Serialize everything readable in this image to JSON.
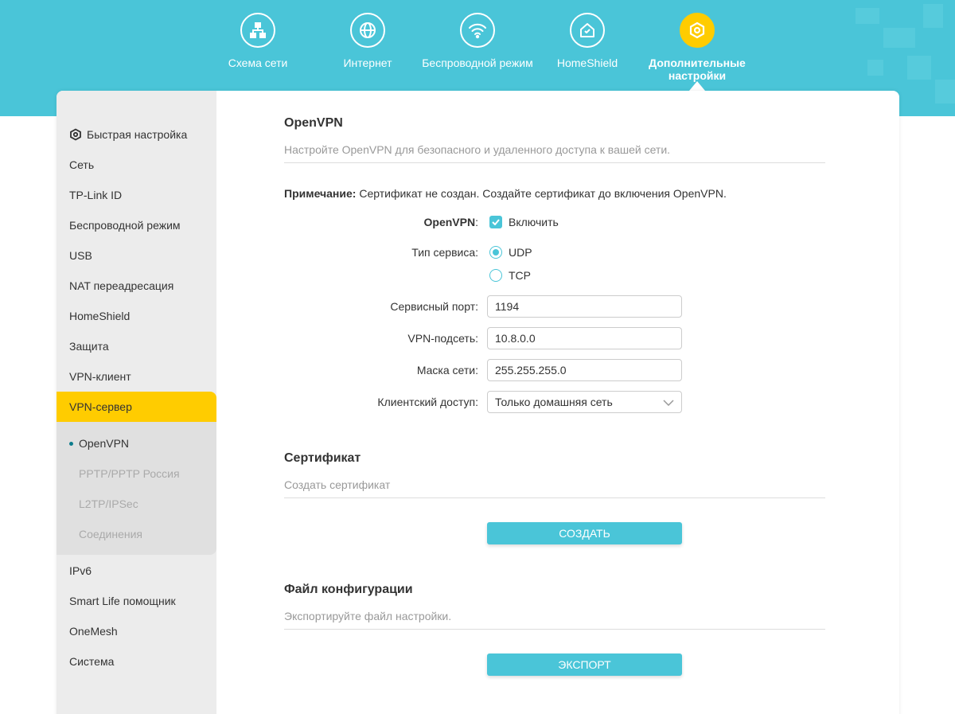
{
  "colors": {
    "accent": "#4ac5d8",
    "active": "#ffcc00",
    "dot": "#0d7c8c"
  },
  "topnav": [
    {
      "label": "Схема сети",
      "icon": "network-map-icon"
    },
    {
      "label": "Интернет",
      "icon": "globe-icon"
    },
    {
      "label": "Беспроводной режим",
      "icon": "wifi-icon"
    },
    {
      "label": "HomeShield",
      "icon": "home-shield-icon"
    },
    {
      "label": "Дополнительные настройки",
      "icon": "gear-icon",
      "active": true
    }
  ],
  "sidebar": {
    "items": [
      "Быстрая настройка",
      "Сеть",
      "TP-Link ID",
      "Беспроводной режим",
      "USB",
      "NAT переадресация",
      "HomeShield",
      "Защита",
      "VPN-клиент",
      "VPN-сервер",
      "IPv6",
      "Smart Life помощник",
      "OneMesh",
      "Система"
    ],
    "subitems": [
      "OpenVPN",
      "PPTP/PPTP Россия",
      "L2TP/IPSec",
      "Соединения"
    ]
  },
  "openvpn": {
    "title": "OpenVPN",
    "desc": "Настройте OpenVPN для безопасного и удаленного доступа к вашей сети.",
    "note_label": "Примечание:",
    "note_text": " Сертификат не создан. Создайте сертификат до включения OpenVPN.",
    "enable_label": "OpenVPN",
    "enable_colon": ":",
    "enable_text": "Включить",
    "service_type_label": "Тип сервиса:",
    "udp": "UDP",
    "tcp": "TCP",
    "port_label": "Сервисный порт:",
    "port_value": "1194",
    "subnet_label": "VPN-подсеть:",
    "subnet_value": "10.8.0.0",
    "mask_label": "Маска сети:",
    "mask_value": "255.255.255.0",
    "access_label": "Клиентский доступ:",
    "access_value": "Только домашняя сеть"
  },
  "certificate": {
    "title": "Сертификат",
    "desc": "Создать сертификат",
    "button": "СОЗДАТЬ"
  },
  "config": {
    "title": "Файл конфигурации",
    "desc": "Экспортируйте файл настройки.",
    "button": "ЭКСПОРТ"
  }
}
